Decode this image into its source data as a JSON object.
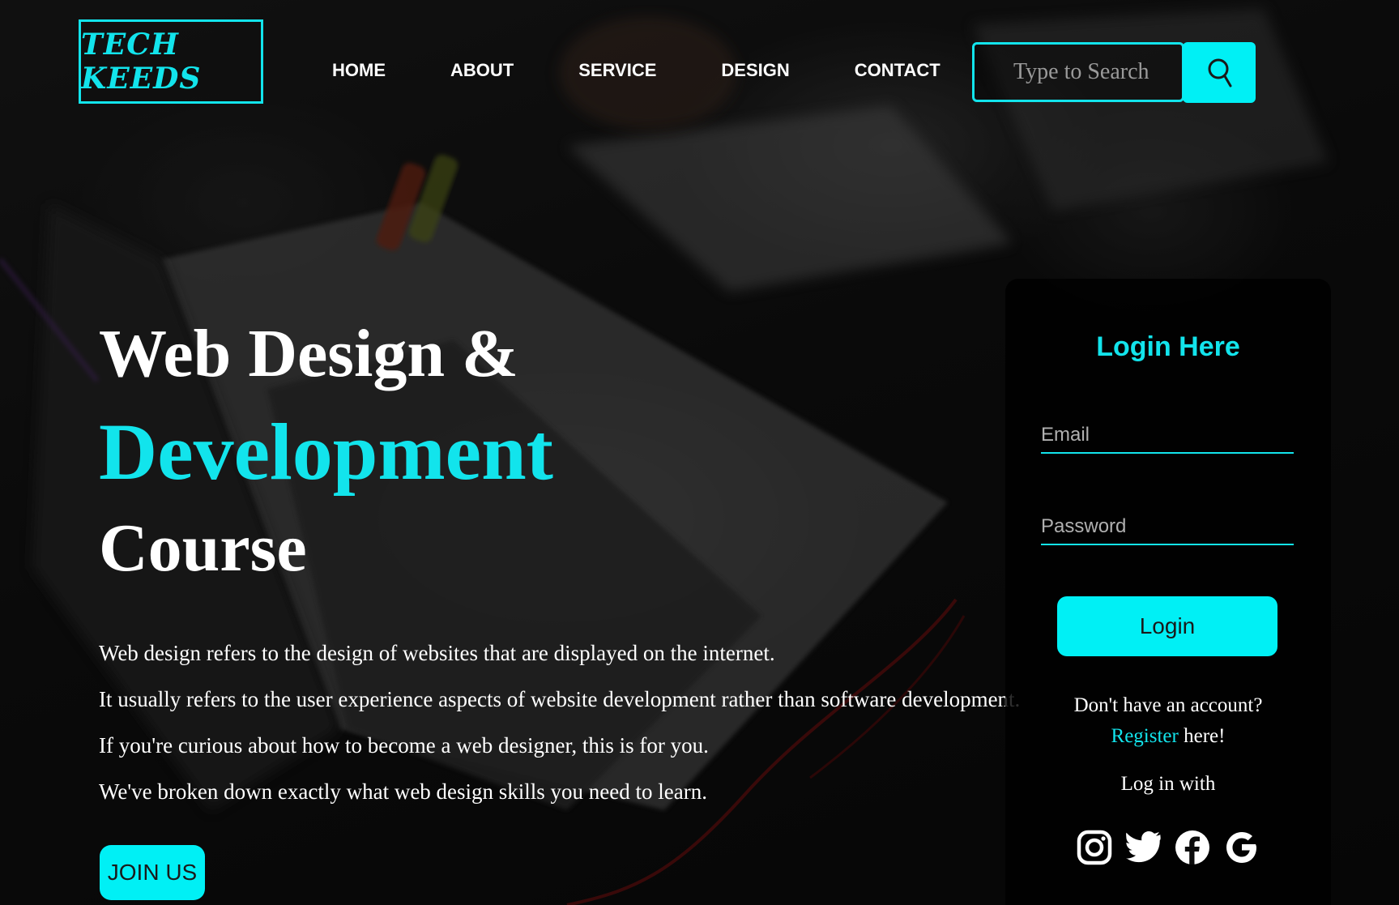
{
  "header": {
    "logo_text": "TECH KEEDS",
    "nav": [
      {
        "label": "HOME"
      },
      {
        "label": "ABOUT"
      },
      {
        "label": "SERVICE"
      },
      {
        "label": "DESIGN"
      },
      {
        "label": "CONTACT"
      }
    ],
    "search": {
      "placeholder": "Type to Search",
      "icon": "search-icon"
    }
  },
  "hero": {
    "line1": "Web Design &",
    "line2": "Development",
    "line3": "Course",
    "paragraphs": [
      "Web design refers to the design of websites that are displayed on the internet.",
      "It usually refers to the user experience aspects of website development rather than software development.",
      "If you're curious about how to become a web designer, this is for you.",
      "We've broken down exactly what web design skills you need to learn."
    ],
    "join_label": "JOIN US"
  },
  "login": {
    "title": "Login Here",
    "email_placeholder": "Email",
    "password_placeholder": "Password",
    "button_label": "Login",
    "no_account_text": "Don't have an account?",
    "register_link": "Register",
    "register_suffix": " here!",
    "login_with_text": "Log in with",
    "social": [
      "instagram-icon",
      "twitter-icon",
      "facebook-icon",
      "google-icon"
    ]
  },
  "colors": {
    "accent": "#12e4ec",
    "button": "#00f0f5",
    "background": "#0c0c0c",
    "text": "#ffffff"
  }
}
